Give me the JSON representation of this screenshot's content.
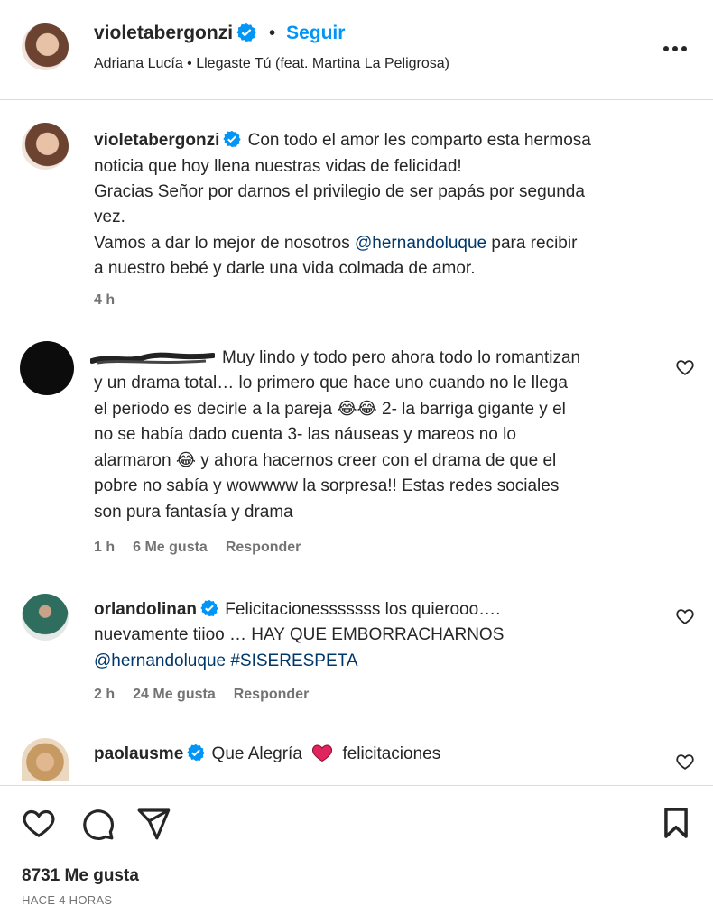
{
  "header": {
    "username": "violetabergonzi",
    "separator": "•",
    "follow_label": "Seguir",
    "audio": "Adriana Lucía • Llegaste Tú (feat. Martina La Peligrosa)"
  },
  "caption": {
    "username": "violetabergonzi",
    "line1": "Con todo el amor les comparto esta hermosa",
    "line2": "noticia que hoy llena nuestras vidas de felicidad!",
    "line3": "Gracias Señor por darnos el privilegio de ser papás por segunda",
    "line4": "vez.",
    "line5_pre": "Vamos a dar lo mejor de nosotros ",
    "line5_mention": "@hernandoluque",
    "line5_post": " para recibir",
    "line6": "a nuestro bebé y darle una vida colmada de amor.",
    "time": "4 h"
  },
  "comments": [
    {
      "username": "",
      "lines": [
        "Muy lindo y todo pero ahora todo lo romantizan",
        "y un drama total… lo primero que hace uno cuando no le llega",
        "el periodo es decirle a la pareja 😂😂 2- la barriga gigante y el",
        "no se había dado cuenta 3- las náuseas y mareos no lo",
        "alarmaron 😂 y ahora hacernos creer con el drama de que el",
        "pobre no sabía y wowwww la sorpresa!! Estas redes sociales",
        "son pura fantasía y drama"
      ],
      "time": "1 h",
      "likes": "6 Me gusta",
      "reply": "Responder"
    },
    {
      "username": "orlandolinan",
      "line1": "Felicitacionesssssss los quierooo….",
      "line2": "nuevamente tiioo … HAY QUE EMBORRACHARNOS",
      "line3_mention1": "@hernandoluque",
      "line3_mention2": "#SISERESPETA",
      "time": "2 h",
      "likes": "24 Me gusta",
      "reply": "Responder"
    },
    {
      "username": "paolausme",
      "text_pre": "Que Alegría",
      "text_post": "felicitaciones"
    }
  ],
  "footer": {
    "likes": "8731 Me gusta",
    "time": "HACE 4 HORAS"
  },
  "colors": {
    "verified": "#0095f6",
    "follow": "#0095f6",
    "mention": "#00376b",
    "heart_red": "#e0245e"
  }
}
